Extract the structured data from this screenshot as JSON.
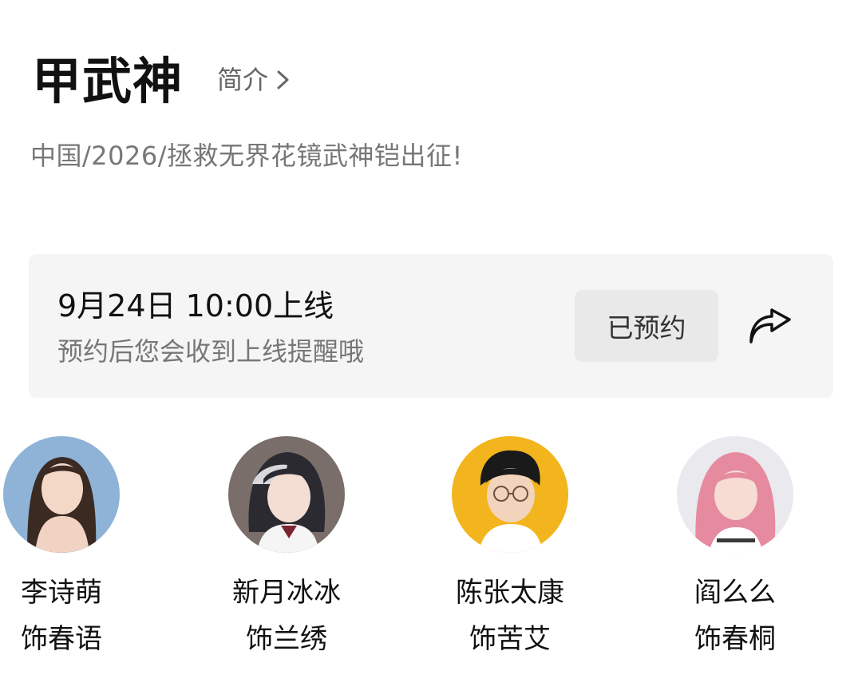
{
  "header": {
    "title": "甲武神",
    "intro_label": "简介"
  },
  "meta": "中国/2026/拯救无界花镜武神铠出征!",
  "schedule": {
    "date": "9月24日 10:00上线",
    "hint": "预约后您会收到上线提醒哦",
    "reserve_label": "已预约",
    "share_icon": "share-arrow-icon"
  },
  "cast": [
    {
      "name": "李诗萌",
      "role": "饰春语",
      "avatar_bg": "#8fb3d6"
    },
    {
      "name": "新月冰冰",
      "role": "饰兰绣",
      "avatar_bg": "#7a6e6a"
    },
    {
      "name": "陈张太康",
      "role": "饰苦艾",
      "avatar_bg": "#f2b51d"
    },
    {
      "name": "阎么么",
      "role": "饰春桐",
      "avatar_bg": "#e9e9ee"
    }
  ]
}
